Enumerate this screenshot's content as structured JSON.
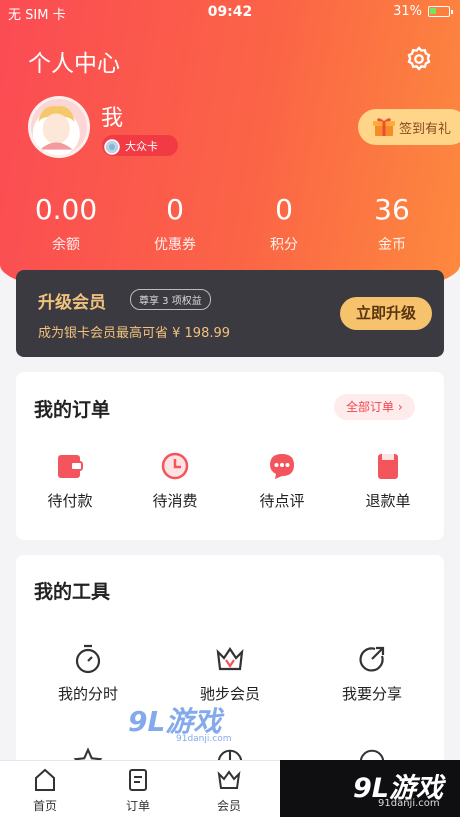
{
  "status_bar": {
    "carrier": "无 SIM 卡",
    "time": "09:42",
    "battery": "31%"
  },
  "header": {
    "title": "个人中心",
    "username": "我",
    "card_level": "大众卡",
    "checkin_label": "签到有礼"
  },
  "stats": [
    {
      "value": "0.00",
      "label": "余额"
    },
    {
      "value": "0",
      "label": "优惠券"
    },
    {
      "value": "0",
      "label": "积分"
    },
    {
      "value": "36",
      "label": "金币"
    }
  ],
  "upgrade": {
    "title": "升级会员",
    "tag": "尊享 3 项权益",
    "subtitle": "成为银卡会员最高可省 ¥ 198.99",
    "button": "立即升级"
  },
  "orders": {
    "title": "我的订单",
    "all_label": "全部订单",
    "items": [
      {
        "label": "待付款",
        "icon": "wallet-icon"
      },
      {
        "label": "待消费",
        "icon": "clock-icon"
      },
      {
        "label": "待点评",
        "icon": "comment-icon"
      },
      {
        "label": "退款单",
        "icon": "refund-icon"
      }
    ]
  },
  "tools": {
    "title": "我的工具",
    "items": [
      {
        "label": "我的分时",
        "icon": "stopwatch-icon"
      },
      {
        "label": "驰步会员",
        "icon": "crown-icon"
      },
      {
        "label": "我要分享",
        "icon": "share-icon"
      }
    ]
  },
  "tabbar": [
    {
      "label": "首页",
      "icon": "home-icon"
    },
    {
      "label": "订单",
      "icon": "order-icon"
    },
    {
      "label": "会员",
      "icon": "member-crown-icon"
    }
  ],
  "watermark": {
    "brand": "9L游戏",
    "url": "91danji.com"
  },
  "colors": {
    "primary": "#fb4b54",
    "accent_gold": "#f6c26b",
    "dark_card": "#3b3a40"
  }
}
